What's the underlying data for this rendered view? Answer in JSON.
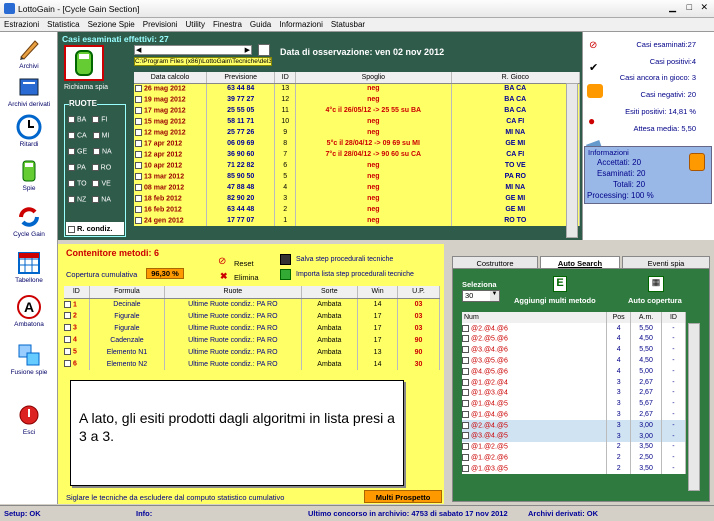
{
  "window": {
    "title": "LottoGain - [Cycle Gain Section]"
  },
  "menu": [
    "Estrazioni",
    "Statistica",
    "Sezione Spie",
    "Previsioni",
    "Utility",
    "Finestra",
    "Guida",
    "Informazioni",
    "Statusbar"
  ],
  "toolbar": [
    {
      "label": "Archivi"
    },
    {
      "label": "Archivi derivati"
    },
    {
      "label": "Ritardi"
    },
    {
      "label": "Spie"
    },
    {
      "label": "Cycle Gain"
    },
    {
      "label": "Tabellone"
    },
    {
      "label": "Ambatona"
    },
    {
      "label": "Fusione spie"
    },
    {
      "label": "Esci"
    }
  ],
  "upper": {
    "header": "Casi esaminati effettivi: 27",
    "spia_label": "Richiama spia",
    "path": "C:\\Program Files (x86)\\LottoGain\\Tecniche\\del30.egv",
    "observation_date": "Data di osservazione:  ven 02 nov 2012",
    "ruote_title": "RUOTE",
    "ruote": [
      "BA",
      "FI",
      "CA",
      "MI",
      "GE",
      "NA",
      "PA",
      "RO",
      "TO",
      "VE",
      "NZ",
      "NA"
    ],
    "r_condiz": "R. condiz.",
    "columns": [
      "Data calcolo",
      "Previsione",
      "ID",
      "Spoglio",
      "R. Gioco"
    ],
    "rows": [
      [
        "26 mag 2012",
        "63 44 84",
        "13",
        "neg",
        "BA CA"
      ],
      [
        "19 mag 2012",
        "39 77 27",
        "12",
        "neg",
        "BA CA"
      ],
      [
        "17 mag 2012",
        "25 55 05",
        "11",
        "4°c il 26/05/12 -> 25 55 su BA",
        "BA CA"
      ],
      [
        "15 mag 2012",
        "58 11 71",
        "10",
        "neg",
        "CA FI"
      ],
      [
        "12 mag 2012",
        "25 77 26",
        "9",
        "neg",
        "MI NA"
      ],
      [
        "17 apr 2012",
        "06 09 69",
        "8",
        "5°c il 28/04/12 -> 09 69 su MI",
        "GE MI"
      ],
      [
        "12 apr 2012",
        "36 90 60",
        "7",
        "7°c il 28/04/12 -> 90 60 su CA",
        "CA FI"
      ],
      [
        "10 apr 2012",
        "71 22 82",
        "6",
        "neg",
        "TO VE"
      ],
      [
        "13 mar 2012",
        "85 90 50",
        "5",
        "neg",
        "PA RO"
      ],
      [
        "08 mar 2012",
        "47 88 48",
        "4",
        "neg",
        "MI NA"
      ],
      [
        "18 feb 2012",
        "82 90 20",
        "3",
        "neg",
        "GE MI"
      ],
      [
        "16 feb 2012",
        "63 44 48",
        "2",
        "neg",
        "GE MI"
      ],
      [
        "24 gen 2012",
        "17 77 07",
        "1",
        "neg",
        "RO TO"
      ]
    ]
  },
  "stats": {
    "casi_esaminati": "Casi esaminati:27",
    "casi_positivi": "Casi positivi:4",
    "casi_in_gioco": "Casi ancora in gioco: 3",
    "casi_negativi": "Casi negativi: 20",
    "esiti_positivi": "Esiti positivi: 14,81 %",
    "attesa_media": "Attesa media: 5,50"
  },
  "informazioni": {
    "title": "Informazioni",
    "accettati": "Accettati:  20",
    "esaminati": "Esaminati:  20",
    "totali": "Totali:  20",
    "processing": "Processing:  100 %"
  },
  "lower": {
    "header": "Contenitore metodi: 6",
    "copertura_label": "Copertura cumulativa",
    "copertura_value": "96,30 %",
    "reset": "Reset",
    "elimina": "Elimina",
    "salva": "Salva step procedurali tecniche",
    "importa": "Importa lista step procedurali tecniche",
    "columns": [
      "ID",
      "Formula",
      "Ruote",
      "Sorte",
      "Win",
      "U.P."
    ],
    "rows": [
      [
        "1",
        "Decinale",
        "Ultime Ruote condiz.: PA RO",
        "Ambata",
        "14",
        "03"
      ],
      [
        "2",
        "Figurale",
        "Ultime Ruote condiz.: PA RO",
        "Ambata",
        "17",
        "03"
      ],
      [
        "3",
        "Figurale",
        "Ultime Ruote condiz.: PA RO",
        "Ambata",
        "17",
        "03"
      ],
      [
        "4",
        "Cadenzale",
        "Ultime Ruote condiz.: PA RO",
        "Ambata",
        "17",
        "90"
      ],
      [
        "5",
        "Elemento N1",
        "Ultime Ruote condiz.: PA RO",
        "Ambata",
        "13",
        "90"
      ],
      [
        "6",
        "Elemento N2",
        "Ultime Ruote condiz.: PA RO",
        "Ambata",
        "14",
        "30"
      ]
    ],
    "message": "A lato, gli esiti prodotti dagli algoritmi in lista presi a 3 a 3.",
    "footer_text": "Siglare le tecniche da escludere dal computo statistico cumulativo",
    "multi_prospetto": "Multi Prospetto"
  },
  "tabs": [
    "Costruttore",
    "Auto Search",
    "Eventi spia"
  ],
  "auto_search": {
    "seleziona_label": "Seleziona",
    "seleziona_value": "30",
    "aggiungi": "Aggiungi multi metodo",
    "auto_copertura": "Auto copertura",
    "columns": [
      "Num",
      "Pos",
      "A.m.",
      "ID"
    ],
    "rows": [
      [
        "@2.@4.@6",
        "4",
        "5,50",
        "-"
      ],
      [
        "@2.@5.@6",
        "4",
        "4,50",
        "-"
      ],
      [
        "@3.@4.@6",
        "4",
        "5,50",
        "-"
      ],
      [
        "@3.@5.@6",
        "4",
        "4,50",
        "-"
      ],
      [
        "@4.@5.@6",
        "4",
        "5,00",
        "-"
      ],
      [
        "@1.@2.@4",
        "3",
        "2,67",
        "-"
      ],
      [
        "@1.@3.@4",
        "3",
        "2,67",
        "-"
      ],
      [
        "@1.@4.@5",
        "3",
        "5,67",
        "-"
      ],
      [
        "@1.@4.@6",
        "3",
        "2,67",
        "-"
      ],
      [
        "@2.@4.@5",
        "3",
        "3,00",
        "-"
      ],
      [
        "@3.@4.@5",
        "3",
        "3,00",
        "-"
      ],
      [
        "@1.@2.@5",
        "2",
        "3,50",
        "-"
      ],
      [
        "@1.@2.@6",
        "2",
        "2,50",
        "-"
      ],
      [
        "@1.@3.@5",
        "2",
        "3,50",
        "-"
      ]
    ]
  },
  "statusbar": {
    "setup": "Setup: OK",
    "info": "Info:",
    "ultimo": "Ultimo concorso in archivio: 4753 di sabato 17 nov 2012",
    "archivi": "Archivi derivati: OK"
  }
}
